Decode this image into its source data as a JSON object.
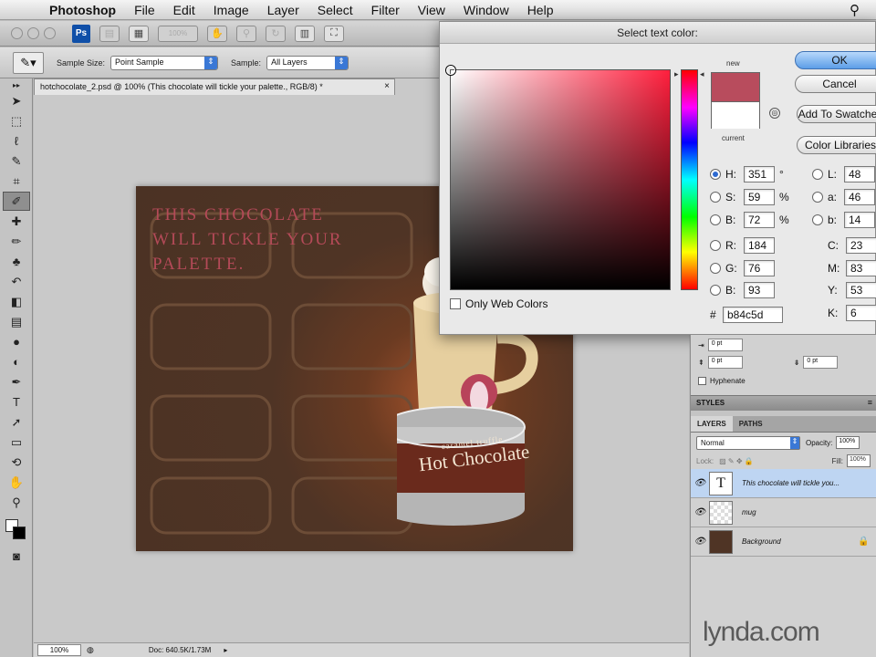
{
  "menubar": {
    "app_name": "Photoshop",
    "items": [
      "File",
      "Edit",
      "Image",
      "Layer",
      "Select",
      "Filter",
      "View",
      "Window",
      "Help"
    ]
  },
  "appbar": {
    "ps_badge": "Ps",
    "zoom_label": "100%"
  },
  "options": {
    "sample_size_label": "Sample Size:",
    "sample_size_value": "Point Sample",
    "sample_label": "Sample:",
    "sample_value": "All Layers"
  },
  "document": {
    "tab_title": "hotchocolate_2.psd @ 100% (This chocolate will tickle your palette., RGB/8) *",
    "tab_close": "×",
    "headline": "This chocolate will tickle your palette.",
    "can_subtitle": "caramel truffle",
    "can_title": "Hot Chocolate"
  },
  "statusbar": {
    "zoom": "100%",
    "doc_info": "Doc: 640.5K/1.73M"
  },
  "dialog": {
    "title": "Select text color:",
    "ok": "OK",
    "cancel": "Cancel",
    "add_to_swatches": "Add To Swatches",
    "color_libraries": "Color Libraries",
    "label_new": "new",
    "label_current": "current",
    "new_color": "#b84c5d",
    "current_color": "#ffffff",
    "only_web_colors": "Only Web Colors",
    "hsb": [
      {
        "label": "H:",
        "value": "351",
        "unit": "°",
        "selected": true
      },
      {
        "label": "S:",
        "value": "59",
        "unit": "%",
        "selected": false
      },
      {
        "label": "B:",
        "value": "72",
        "unit": "%",
        "selected": false
      }
    ],
    "rgb": [
      {
        "label": "R:",
        "value": "184"
      },
      {
        "label": "G:",
        "value": "76"
      },
      {
        "label": "B:",
        "value": "93"
      }
    ],
    "lab": [
      {
        "label": "L:",
        "value": "48"
      },
      {
        "label": "a:",
        "value": "46"
      },
      {
        "label": "b:",
        "value": "14"
      }
    ],
    "cmyk": [
      {
        "label": "C:",
        "value": "23",
        "unit": "%"
      },
      {
        "label": "M:",
        "value": "83",
        "unit": "%"
      },
      {
        "label": "Y:",
        "value": "53",
        "unit": "%"
      },
      {
        "label": "K:",
        "value": "6",
        "unit": "%"
      }
    ],
    "hex_label": "#",
    "hex_value": "b84c5d"
  },
  "paragraph": {
    "indent1": "0 pt",
    "indent2": "0 pt",
    "indent3": "0 pt",
    "hyphenate": "Hyphenate"
  },
  "styles_panel": {
    "title": "STYLES"
  },
  "layers_panel": {
    "tab_layers": "LAYERS",
    "tab_paths": "PATHS",
    "blend_mode": "Normal",
    "opacity_label": "Opacity:",
    "opacity": "100%",
    "lock_label": "Lock:",
    "fill_label": "Fill:",
    "fill": "100%",
    "layers": [
      {
        "name": "This chocolate will tickle you...",
        "thumb": "T",
        "active": true
      },
      {
        "name": "mug",
        "thumb": "",
        "active": false
      },
      {
        "name": "Background",
        "thumb": "",
        "active": false
      }
    ]
  },
  "watermark": "lynda.com"
}
